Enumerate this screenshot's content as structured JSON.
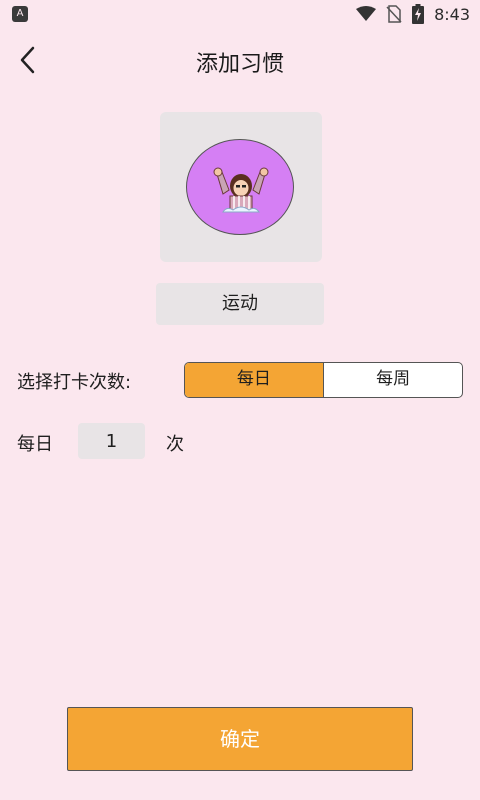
{
  "status_bar": {
    "time": "8:43",
    "left_icon": "A",
    "icons": [
      "wifi-icon",
      "no-sim-icon",
      "battery-charging-icon"
    ]
  },
  "header": {
    "title": "添加习惯",
    "back_icon": "chevron-left-icon"
  },
  "habit": {
    "icon": "cheering-person-icon",
    "category": "运动"
  },
  "frequency": {
    "label": "选择打卡次数:",
    "options": [
      "每日",
      "每周"
    ],
    "selected": "每日"
  },
  "count": {
    "prefix": "每日",
    "value": "1",
    "suffix": "次"
  },
  "confirm_label": "确定",
  "colors": {
    "background": "#fbe7ee",
    "accent": "#f4a534",
    "icon_circle": "#d57ff4",
    "card": "#e8e4e6"
  }
}
